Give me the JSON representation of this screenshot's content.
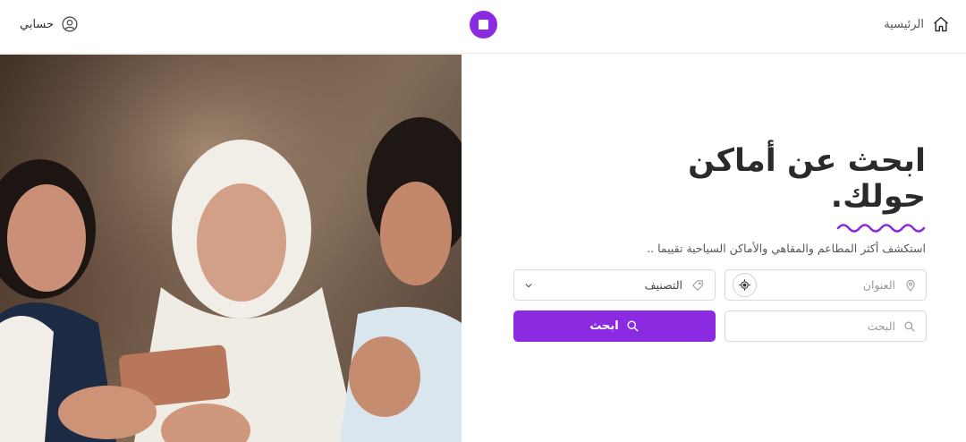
{
  "header": {
    "home_label": "الرئيسية",
    "account_label": "حسابي"
  },
  "hero": {
    "title_line1": "ابحث عن أماكن",
    "title_line2": "حولك.",
    "subtitle": "استكشف أكثر المطاعم والمقاهي والأماكن السياحية تقييما .."
  },
  "form": {
    "address_placeholder": "العنوان",
    "category_value": "التصنيف",
    "search_placeholder": "البحث",
    "search_button_label": "ابحث"
  },
  "colors": {
    "accent": "#8a2be2",
    "border": "#d9d9d9",
    "title": "#2a2a2a"
  },
  "icons": [
    "home-icon",
    "user-icon",
    "logo-icon",
    "location-pin-icon",
    "locate-icon",
    "tag-icon",
    "chevron-down-icon",
    "search-icon"
  ]
}
